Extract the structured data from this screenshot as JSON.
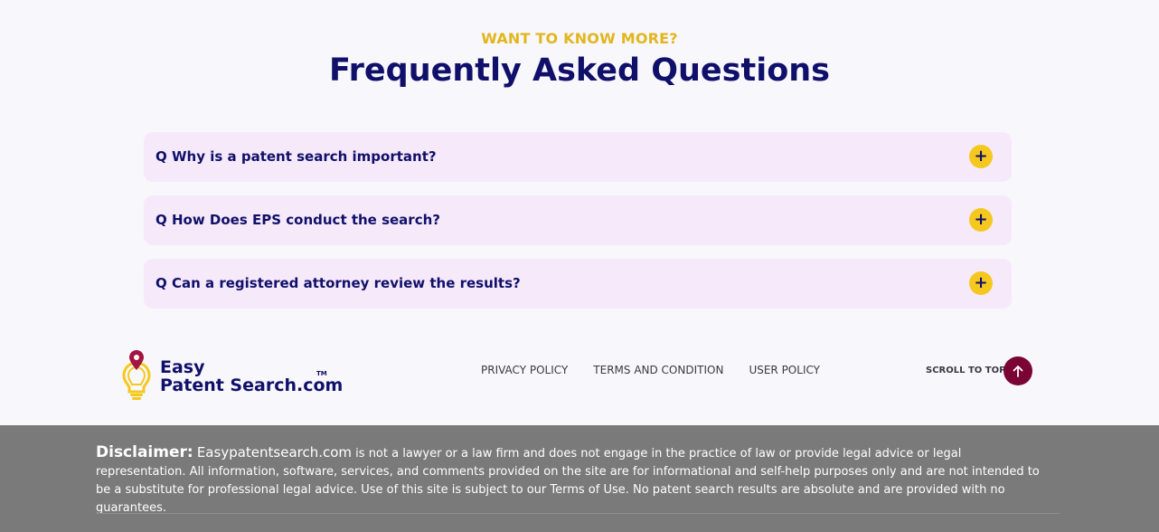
{
  "faq": {
    "eyebrow": "WANT TO KNOW MORE?",
    "title": "Frequently Asked Questions",
    "items": [
      {
        "question": "Q Why is a patent search important?",
        "toggle": "+"
      },
      {
        "question": "Q How Does EPS conduct the search?",
        "toggle": "+"
      },
      {
        "question": "Q Can a registered attorney review the results?",
        "toggle": "+"
      }
    ]
  },
  "footer": {
    "logo": {
      "line1": "Easy",
      "line2": "Patent Search.com",
      "tm": "TM"
    },
    "links": [
      "PRIVACY POLICY",
      "TERMS AND CONDITION",
      "USER POLICY"
    ],
    "scroll_top_label": "SCROLL TO TOP"
  },
  "disclaimer": {
    "label": "Disclaimer:",
    "site": "Easypatentsearch.com",
    "body": " is not a lawyer or a law firm and does not engage in the practice of law or provide legal advice or legal representation. All information, software, services, and comments provided on the site are for informational and self-help purposes only and are not intended to be a substitute for professional legal advice. Use of this site is subject to our Terms of Use. No patent search results are absolute and are provided with no guarantees."
  },
  "colors": {
    "accent_yellow": "#f5c81f",
    "navy": "#10106a",
    "scroll_button": "#7a0534",
    "disclaimer_bg": "#7a7a7a"
  },
  "icons": {
    "logo": "lightbulb-pin-icon",
    "toggle": "plus-icon",
    "scroll": "arrow-up-icon"
  }
}
